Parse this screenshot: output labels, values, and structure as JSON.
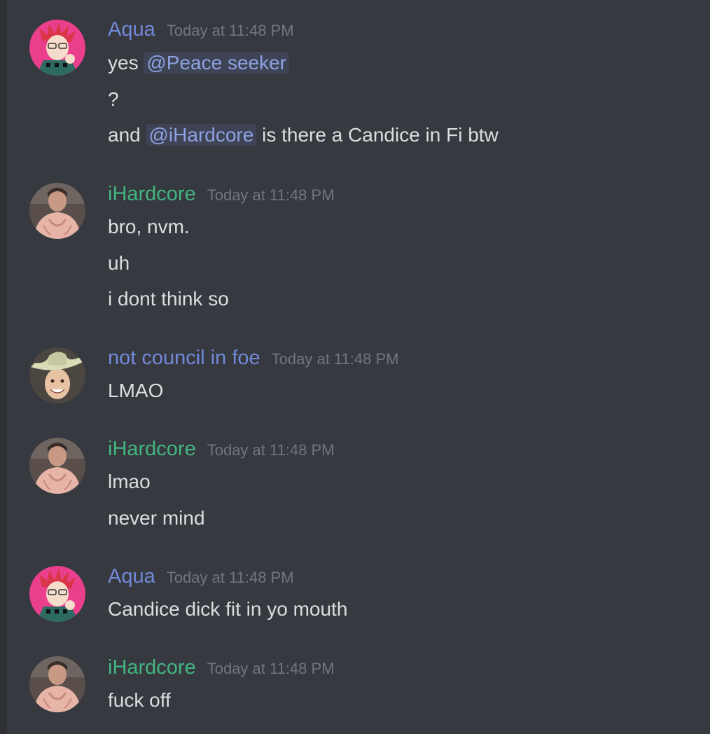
{
  "colors": {
    "background": "#36393f",
    "text": "#dcddde",
    "timestamp": "#72767d",
    "mention_text": "#8ea1e1",
    "aqua_name": "#7289da",
    "ihardcore_name": "#43b581",
    "council_name": "#7289da"
  },
  "messages": [
    {
      "author": "Aqua",
      "avatar_icon": "anime-avatar-icon",
      "timestamp": "Today at 11:48 PM",
      "lines": [
        {
          "pre": "yes ",
          "mention": "@Peace seeker",
          "post": ""
        },
        {
          "text": "?"
        },
        {
          "pre": "and ",
          "mention": "@iHardcore",
          "post": " is there a Candice in Fi btw"
        }
      ]
    },
    {
      "author": "iHardcore",
      "avatar_icon": "photo-avatar-icon",
      "timestamp": "Today at 11:48 PM",
      "lines": [
        {
          "text": "bro, nvm."
        },
        {
          "text": "uh"
        },
        {
          "text": "i dont think so"
        }
      ]
    },
    {
      "author": "not council in foe",
      "avatar_icon": "cowboy-hat-avatar-icon",
      "timestamp": "Today at 11:48 PM",
      "lines": [
        {
          "text": "LMAO"
        }
      ]
    },
    {
      "author": "iHardcore",
      "avatar_icon": "photo-avatar-icon",
      "timestamp": "Today at 11:48 PM",
      "lines": [
        {
          "text": "lmao"
        },
        {
          "text": "never mind"
        }
      ]
    },
    {
      "author": "Aqua",
      "avatar_icon": "anime-avatar-icon",
      "timestamp": "Today at 11:48 PM",
      "lines": [
        {
          "text": "Candice dick fit in yo mouth"
        }
      ]
    },
    {
      "author": "iHardcore",
      "avatar_icon": "photo-avatar-icon",
      "timestamp": "Today at 11:48 PM",
      "lines": [
        {
          "text": "fuck off"
        }
      ]
    }
  ]
}
